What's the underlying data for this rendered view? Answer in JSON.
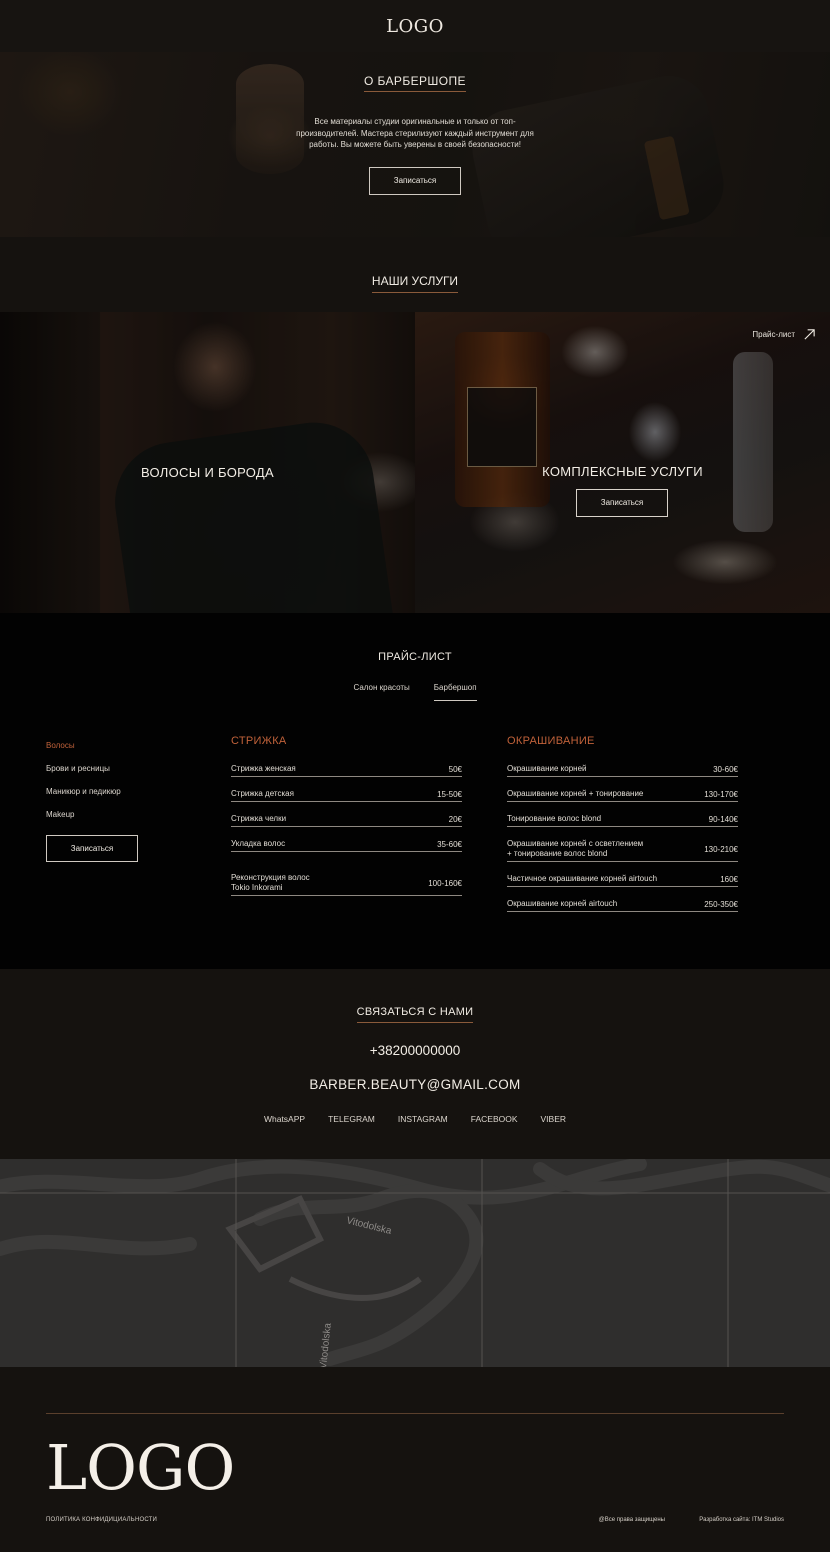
{
  "header": {
    "logo": "LOGO"
  },
  "about": {
    "title": "О БАРБЕРШОПЕ",
    "text": "Все материалы студии оригинальные и только от топ-производителей. Мастера стерилизуют каждый инструмент для работы. Вы можете быть уверены в своей безопасности!",
    "button": "Записаться"
  },
  "services": {
    "title": "НАШИ УСЛУГИ",
    "left": {
      "name": "ВОЛОСЫ И БОРОДА"
    },
    "right": {
      "name": "КОМПЛЕКСНЫЕ УСЛУГИ",
      "button": "Записаться",
      "price_link": "Прайс-лист"
    }
  },
  "price": {
    "title": "ПРАЙС-ЛИСТ",
    "tabs": [
      "Салон красоты",
      "Барбершоп"
    ],
    "active_tab": "Барбершоп",
    "categories": [
      "Волосы",
      "Брови и ресницы",
      "Маникюр и педикюр",
      "Makeup"
    ],
    "active_category": "Волосы",
    "button": "Записаться",
    "col1": {
      "title": "СТРИЖКА",
      "rows": [
        {
          "name": "Стрижка женская",
          "price": "50€"
        },
        {
          "name": "Стрижка детская",
          "price": "15-50€"
        },
        {
          "name": "Стрижка челки",
          "price": "20€"
        },
        {
          "name": "Укладка волос",
          "price": "35-60€"
        },
        {
          "name_line1": "Реконструкция волос",
          "name_line2": "Tokio Inkorami",
          "price": "100-160€"
        }
      ]
    },
    "col2": {
      "title": "ОКРАШИВАНИЕ",
      "rows": [
        {
          "name": "Окрашивание корней",
          "price": "30-60€"
        },
        {
          "name": "Окрашивание корней + тонирование",
          "price": "130-170€"
        },
        {
          "name": "Тонирование волос blond",
          "price": "90-140€"
        },
        {
          "name_line1": "Окрашивание корней с осветлением",
          "name_line2": " + тонирование волос blond",
          "price": "130-210€"
        },
        {
          "name": "Частичное окрашивание корней airtouch",
          "price": "160€"
        },
        {
          "name": "Окрашивание корней airtouch",
          "price": "250-350€"
        }
      ]
    }
  },
  "contacts": {
    "title": "СВЯЗАТЬСЯ С НАМИ",
    "phone": "+38200000000",
    "email": "BARBER.BEAUTY@GMAIL.COM",
    "social": [
      "WhatsAPP",
      "TELEGRAM",
      "INSTAGRAM",
      "FACEBOOK",
      "VIBER"
    ]
  },
  "map": {
    "street1": "Vitodolska",
    "street2": "Vitodolska"
  },
  "footer": {
    "logo": "LOGO",
    "policy": "ПОЛИТИКА КОНФИДИЦИАЛЬНОСТИ",
    "rights": "@Все права защищены",
    "developer": "Разработка сайта: ITM Studios"
  },
  "colors": {
    "accent": "#c1623a",
    "dark": "#15120f",
    "black": "#020202"
  },
  "icons": {
    "price_link": "arrow-up-right-icon"
  }
}
